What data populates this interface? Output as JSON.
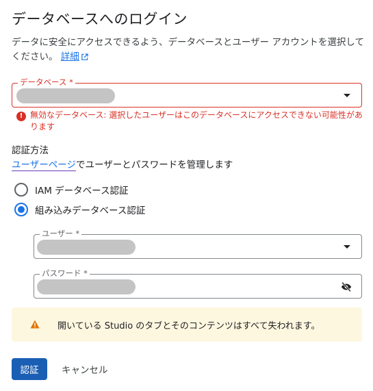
{
  "dialog": {
    "title": "データベースへのログイン",
    "description": "データに安全にアクセスできるよう、データベースとユーザー アカウントを選択してください。",
    "details_link": "詳細"
  },
  "database_field": {
    "label": "データベース *",
    "value": "",
    "error": "無効なデータベース: 選択したユーザーはこのデータベースにアクセスできない可能性があります"
  },
  "auth": {
    "section_label": "認証方法",
    "user_page_link": "ユーザーページ",
    "manage_text": "でユーザーとパスワードを管理します",
    "options": [
      {
        "label": "IAM データベース認証",
        "selected": false
      },
      {
        "label": "組み込みデータベース認証",
        "selected": true
      }
    ]
  },
  "user_field": {
    "label": "ユーザー *",
    "value": ""
  },
  "password_field": {
    "label": "パスワード *",
    "value": ""
  },
  "notice": {
    "text": "開いている Studio のタブとそのコンテンツはすべて失われます。",
    "icon": "warning-icon"
  },
  "actions": {
    "authenticate": "認証",
    "cancel": "キャンセル"
  },
  "colors": {
    "accent": "#1a73e8",
    "error": "#d93025",
    "warning_bg": "#fef7e0",
    "warning_icon": "#e37400",
    "primary_button": "#1a5fb4"
  }
}
